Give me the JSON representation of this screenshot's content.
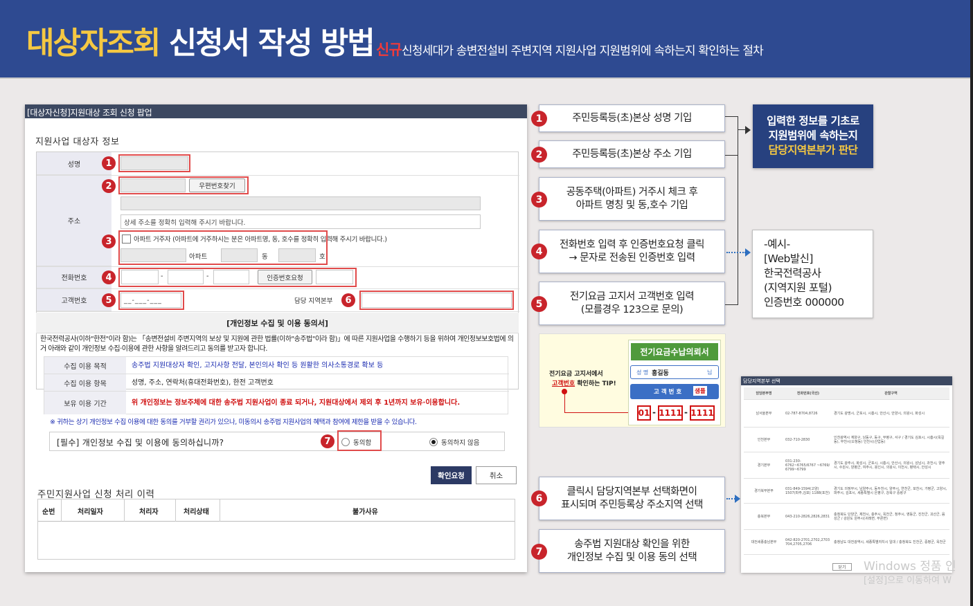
{
  "header": {
    "title_highlight": "대상자조회",
    "title_rest": " 신청서 작성 방법",
    "subtitle_highlight": "신규",
    "subtitle_rest": "신청세대가 송변전설비 주변지역 지원사업 지원범위에 속하는지 확인하는 절차"
  },
  "popup": {
    "title": "[대상자신청]지원대상 조회 신청 팝업",
    "section_title": "지원사업 대상자 정보",
    "labels": {
      "name": "성명",
      "address": "주소",
      "phone": "전화번호",
      "customer_no": "고객번호",
      "region": "담당 지역본부"
    },
    "postcode_button": "우편번호찾기",
    "detail_address_placeholder": "상세 주소를 정확히 입력해 주시기 바랍니다.",
    "apartment_check": "아파트 거주자 (아파트에 거주하시는 분은 아파트명, 동, 호수를 정확히 입력해 주시기 바랍니다.)",
    "apt_label": "아파트",
    "dong_label": "동",
    "ho_label": "호",
    "phone_sep1": "-",
    "phone_sep2": "-",
    "auth_button": "인증번호요청",
    "customer_no_mask": "__-___-___",
    "consent_title": "[개인정보 수집 및 이용 동의서]",
    "consent_text": "한국전력공사(이하\"한전\"이라 함)는 「송변전설비 주변지역의 보상 및 지원에 관한 법률(이하\"송주법\"이라 함)」에 따른 지원사업을 수행하기 등을 위하여 개인정보보호법에 의거 아래와 같이 개인정보 수집·이용에 관한 사항을 알려드리고 동의를 받고자 합니다.",
    "consent_rows": [
      {
        "k": "수집 이용 목적",
        "v": "송주법 지원대상자 확인, 고지사항 전달, 본인의사 확인 등 원활한 의사소통경로 확보 등"
      },
      {
        "k": "수집 이용 항목",
        "v": "성명, 주소, 연락처(휴대전화번호), 한전 고객번호"
      },
      {
        "k": "보유 이용 기간",
        "v": "위 개인정보는 정보주체에 대한 송주법 지원사업이 종료 되거나, 지원대상에서 제외 후 1년까지 보유·이용합니다."
      }
    ],
    "consent_note": "※ 귀하는 상기 개인정보 수집 이용에 대한 동의를 거부할 권리가 있으나, 미동의시 송주법 지원사업의 혜택과 참여에 제한을 받을 수 있습니다.",
    "agree_question": "[필수] 개인정보 수집 및 이용에 동의하십니까?",
    "agree_yes": "동의함",
    "agree_no": "동의하지 않음",
    "confirm_button": "확인요청",
    "cancel_button": "취소",
    "history_title": "주민지원사업 신청 처리 이력",
    "history_columns": [
      "순번",
      "처리일자",
      "처리자",
      "처리상태",
      "불가사유"
    ]
  },
  "markers": [
    "1",
    "2",
    "3",
    "4",
    "5",
    "6",
    "7"
  ],
  "steps": [
    {
      "n": "1",
      "text": "주민등록등(초)본상 성명 기입"
    },
    {
      "n": "2",
      "text": "주민등록등(초)본상 주소 기입"
    },
    {
      "n": "3",
      "l1": "공동주택(아파트) 거주시 체크 후",
      "l2": "아파트 명칭 및 동,호수 기입"
    },
    {
      "n": "4",
      "l1": "전화번호 입력 후 인증번호요청 클릭",
      "l2": "→ 문자로 전송된 인증번호 입력"
    },
    {
      "n": "5",
      "l1": "전기요금 고지서 고객번호 입력",
      "l2": "(모를경우 123으로 문의)"
    },
    {
      "n": "6",
      "l1": "클릭시 담당지역본부 선택화면이",
      "l2": "표시되며 주민등록상 주소지역 선택"
    },
    {
      "n": "7",
      "l1": "송주법 지원대상 확인을 위한",
      "l2": "개인정보 수집 및 이용 동의 선택"
    }
  ],
  "result_box": {
    "l1": "입력한 정보를 기초로",
    "l2": "지원범위에 속하는지",
    "l3": "담당지역본부가 판단"
  },
  "example_box": {
    "l1": "-예시-",
    "l2": "[Web발신]",
    "l3": "한국전력공사",
    "l4": "(지역지원 포털)",
    "l5": "인증번호 000000"
  },
  "tip": {
    "title": "전기요금수납의뢰서",
    "l1": "전기요금 고지서에서",
    "l2_u": "고객번호",
    "l2_rest": " 확인하는 TIP!",
    "name_label": "성 명",
    "name_value": "홍길동",
    "name_suffix": "님",
    "cust_label": "고 객 번 호",
    "cust_tag": "샘플",
    "d1": "01",
    "d2": "1111",
    "d3": "1111",
    "sep": "-"
  },
  "mini_popup": {
    "title": "담당지역본부 선택",
    "columns": [
      "담당본부명",
      "전화번호(국선)",
      "관할구역"
    ],
    "rows": [
      [
        "남서울본부",
        "02-787-8704,8726",
        "경기도 광명시, 군포시, 시흥시, 안산시, 안양시, 의왕시, 화성시"
      ],
      [
        "인천본부",
        "032-710-2830",
        "인천광역시 계양구, 남동구, 동구, 부평구, 서구 / 경기도 김포시, 시흥시(옥길동), 부천시(오정동) 인천시(산업동)"
      ],
      [
        "경기본부",
        "031-230-6762~6765/6767 ~6769/ 6799~6799",
        "경기도 광주시, 화성시, 군포시, 시흥시, 안산시, 의왕시, 성남시, 과천시, 양주시, 수원시, 양평군, 여주시, 용인시, 의왕시, 이천시, 평택시, 안성시"
      ],
      [
        "경기북부본부",
        "031-849-1594(고양) 1507(파주,김포) 1188(포천)",
        "경기도 의정부시, 남양주시, 동두천시, 양주시, 연천군, 포천시, 가평군, 고양시, 파주시, 김포시, 세종특별시 은평구, 강북구 중랑구"
      ],
      [
        "충북본부",
        "043-210-2826,2826,2831",
        "충청북도 단양군, 제천시, 충주시, 옥천군, 청주시, 영동군, 진천군, 괴산군, 음성군 / 강원도 원주시(귀래면, 부론면)"
      ],
      [
        "대전세종충남본부",
        "042-820-2701,2702,2703 704,2705,2706",
        "충청남도 대전광역시, 세종특별자치시 일대 / 충청북도 진천군, 증평군, 옥천군"
      ]
    ],
    "close_button": "닫기"
  },
  "watermark": {
    "l1": "Windows 정품 인",
    "l2": "[설정]으로 이동하여 W"
  },
  "colors": {
    "header_bg": "#2e4a91",
    "title_yellow": "#f5c842",
    "marker_red": "#c8242b",
    "outline_red": "#e04a4a",
    "navy": "#27417f",
    "confirm_btn": "#2c3a64"
  }
}
